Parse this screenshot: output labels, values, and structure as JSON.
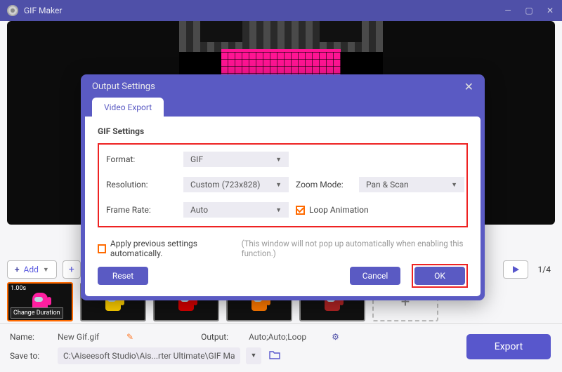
{
  "app": {
    "title": "GIF Maker"
  },
  "toolbar": {
    "add_label": "Add",
    "page_indicator": "1/4"
  },
  "thumbnails": {
    "items": [
      {
        "duration": "1.00s",
        "change_duration_label": "Change Duration",
        "sprite_color": "#ff1fa0"
      },
      {
        "sprite_color": "#ffd000"
      },
      {
        "sprite_color": "#d70000"
      },
      {
        "sprite_color": "#ff7a00"
      },
      {
        "sprite_color": "#b02424"
      }
    ]
  },
  "bottom": {
    "name_label": "Name:",
    "name_value": "New Gif.gif",
    "output_label": "Output:",
    "output_value": "Auto;Auto;Loop",
    "save_to_label": "Save to:",
    "save_to_value": "C:\\Aiseesoft Studio\\Ais...rter Ultimate\\GIF Maker",
    "export_label": "Export"
  },
  "modal": {
    "title": "Output Settings",
    "tab_label": "Video Export",
    "section_heading": "GIF Settings",
    "format_label": "Format:",
    "format_value": "GIF",
    "resolution_label": "Resolution:",
    "resolution_value": "Custom (723x828)",
    "zoom_label": "Zoom Mode:",
    "zoom_value": "Pan & Scan",
    "framerate_label": "Frame Rate:",
    "framerate_value": "Auto",
    "loop_label": "Loop Animation",
    "auto_apply_label": "Apply previous settings automatically.",
    "auto_apply_note": "(This window will not pop up automatically when enabling this function.)",
    "reset_label": "Reset",
    "cancel_label": "Cancel",
    "ok_label": "OK"
  }
}
